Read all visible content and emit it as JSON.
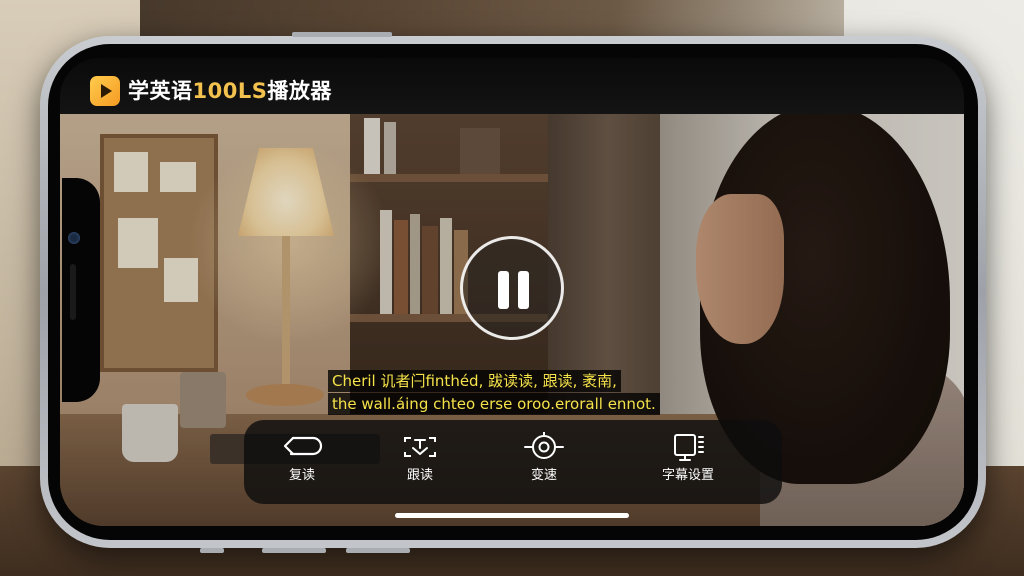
{
  "app": {
    "title_main": "学英语",
    "title_accent": "100LS",
    "title_end": "播放器",
    "logo_icon": "play-logo-icon",
    "accent_color": "#f2c14e"
  },
  "player": {
    "state": "playing",
    "pause_icon": "pause-icon"
  },
  "subtitles": {
    "line1": "Cheril 讥者闩finthéd, 跋读读, 跟读, 袤南,",
    "line2": "the wall.áing chteo erse oroo.erorall ennot.",
    "color": "#f5e24a"
  },
  "controls": [
    {
      "label": "复读",
      "icon": "repeat-back-icon"
    },
    {
      "label": "跟读",
      "icon": "follow-read-icon"
    },
    {
      "label": "变速",
      "icon": "speed-icon"
    },
    {
      "label": "字幕设置",
      "icon": "subtitle-settings-icon"
    }
  ]
}
